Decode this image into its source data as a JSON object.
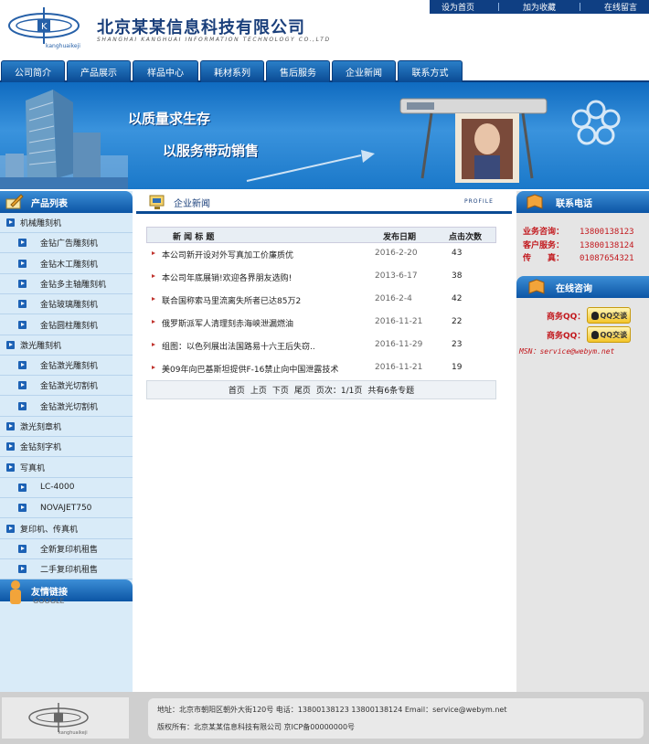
{
  "top_links": [
    "设为首页",
    "加为收藏",
    "在线留言"
  ],
  "header": {
    "company_name": "北京某某信息科技有限公司",
    "company_name_en": "SHANGHAI KANGHUAI INFORMATION TECHNOLOGY CO.,LTD",
    "logo_text": "kanghuaikeji"
  },
  "nav": [
    "公司简介",
    "产品展示",
    "样品中心",
    "耗材系列",
    "售后服务",
    "企业新闻",
    "联系方式"
  ],
  "banner": {
    "slogan1": "以质量求生存",
    "slogan2": "以服务带动销售"
  },
  "sidebar": {
    "products_title": "产品列表",
    "items": [
      {
        "label": "机械雕刻机",
        "level": 1
      },
      {
        "label": "金钻广告雕刻机",
        "level": 2
      },
      {
        "label": "金钻木工雕刻机",
        "level": 2
      },
      {
        "label": "金钻多主轴雕刻机",
        "level": 2
      },
      {
        "label": "金钻玻璃雕刻机",
        "level": 2
      },
      {
        "label": "金钻圆柱雕刻机",
        "level": 2
      },
      {
        "label": "激光雕刻机",
        "level": 1
      },
      {
        "label": "金钻激光雕刻机",
        "level": 2
      },
      {
        "label": "金钻激光切割机",
        "level": 2
      },
      {
        "label": "金钻激光切割机",
        "level": 2
      },
      {
        "label": "激光刻章机",
        "level": 1
      },
      {
        "label": "金钻刻字机",
        "level": 1
      },
      {
        "label": "写真机",
        "level": 1
      },
      {
        "label": "LC-4000",
        "level": 2
      },
      {
        "label": "NOVAJET750",
        "level": 2
      },
      {
        "label": "复印机、传真机",
        "level": 1
      },
      {
        "label": "全新复印机租售",
        "level": 2
      },
      {
        "label": "二手复印机租售",
        "level": 2
      }
    ],
    "links_title": "友情链接",
    "links": [
      "GOOGLE"
    ]
  },
  "main": {
    "section_title": "企业新闻",
    "section_tag": "PROFILE",
    "columns": [
      "新 闻 标 题",
      "发布日期",
      "点击次数"
    ],
    "news": [
      {
        "title": "本公司新开设对外写真加工价廉质优",
        "date": "2016-2-20",
        "clicks": "43"
      },
      {
        "title": "本公司年底展销!欢迎各界朋友选购!",
        "date": "2013-6-17",
        "clicks": "38"
      },
      {
        "title": "联合国称索马里流离失所者已达85万2",
        "date": "2016-2-4",
        "clicks": "42"
      },
      {
        "title": "俄罗斯派军人清理刻赤海峡泄漏燃油",
        "date": "2016-11-21",
        "clicks": "22"
      },
      {
        "title": "组图：以色列展出法国路易十六王后失窃..",
        "date": "2016-11-29",
        "clicks": "23"
      },
      {
        "title": "美09年向巴基斯坦提供F-16禁止向中国泄露技术",
        "date": "2016-11-21",
        "clicks": "19"
      }
    ],
    "pager": [
      "首页",
      "上页",
      "下页",
      "尾页",
      "页次：1/1页",
      "共有6条专题"
    ]
  },
  "right": {
    "contact_title": "联系电话",
    "contacts": [
      {
        "label": "业务咨询：",
        "value": "13800138123"
      },
      {
        "label": "客户服务：",
        "value": "13800138124"
      },
      {
        "label": "传　　真：",
        "value": "01087654321"
      }
    ],
    "online_title": "在线咨询",
    "qq": [
      {
        "label": "商务QQ：",
        "button": "QQ交谈"
      },
      {
        "label": "商务QQ：",
        "button": "QQ交谈"
      }
    ],
    "msn": "MSN：service@webym.net"
  },
  "footer": {
    "address": "地址：北京市朝阳区朝外大街120号 电话：13800138123  13800138124 Email：service@webym.net",
    "copyright": "版权所有：北京某某信息科技有限公司  京ICP备00000000号"
  },
  "colors": {
    "brand_blue": "#0a4a93",
    "sidebar_bg": "#d9ebf8",
    "accent_red": "#c2181d"
  }
}
